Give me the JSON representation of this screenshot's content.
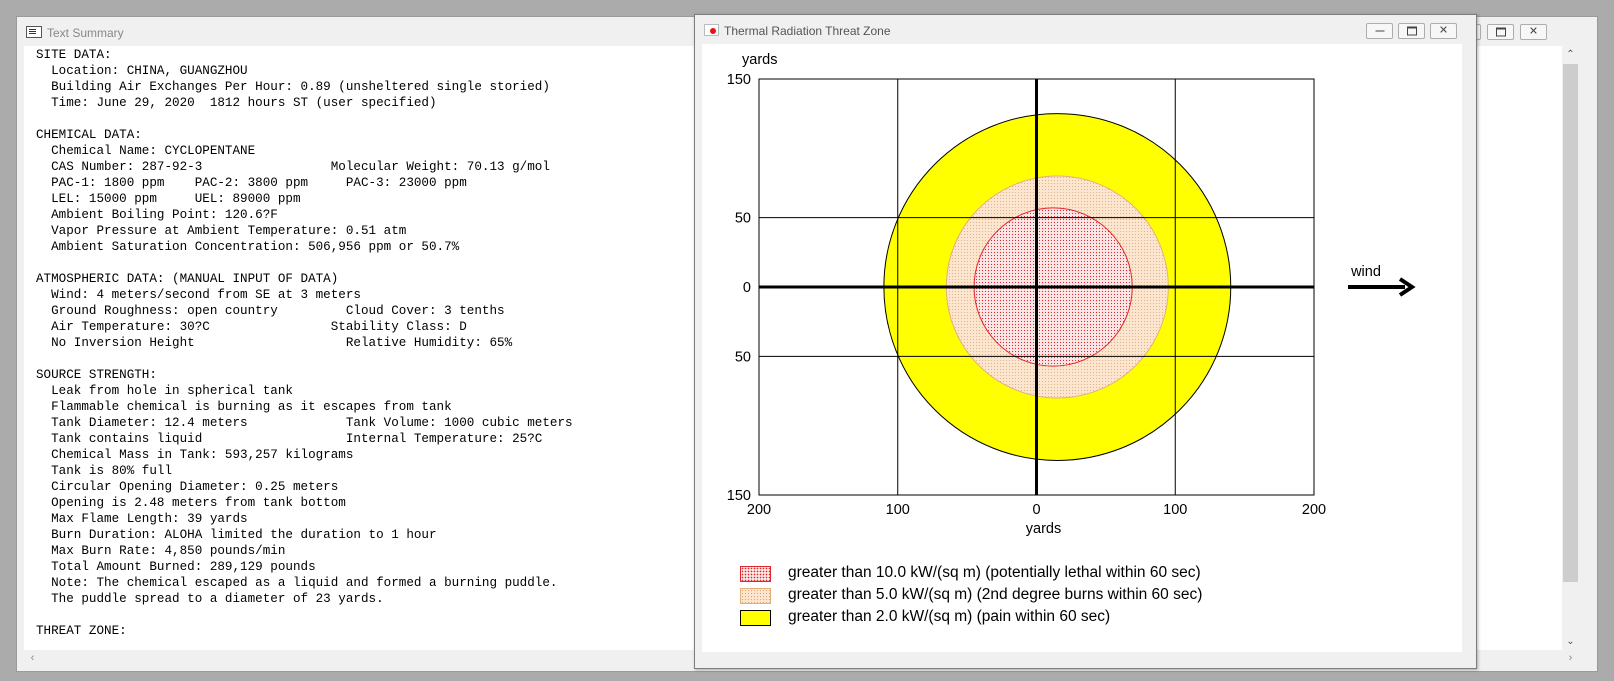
{
  "text_window": {
    "title": "Text Summary",
    "lines": [
      "SITE DATA:",
      "  Location: CHINA, GUANGZHOU",
      "  Building Air Exchanges Per Hour: 0.89 (unsheltered single storied)",
      "  Time: June 29, 2020  1812 hours ST (user specified)",
      "",
      "CHEMICAL DATA:",
      "  Chemical Name: CYCLOPENTANE",
      "  CAS Number: 287-92-3                 Molecular Weight: 70.13 g/mol",
      "  PAC-1: 1800 ppm    PAC-2: 3800 ppm     PAC-3: 23000 ppm",
      "  LEL: 15000 ppm     UEL: 89000 ppm",
      "  Ambient Boiling Point: 120.6?F",
      "  Vapor Pressure at Ambient Temperature: 0.51 atm",
      "  Ambient Saturation Concentration: 506,956 ppm or 50.7%",
      "",
      "ATMOSPHERIC DATA: (MANUAL INPUT OF DATA)",
      "  Wind: 4 meters/second from SE at 3 meters",
      "  Ground Roughness: open country         Cloud Cover: 3 tenths",
      "  Air Temperature: 30?C                Stability Class: D",
      "  No Inversion Height                    Relative Humidity: 65%",
      "",
      "SOURCE STRENGTH:",
      "  Leak from hole in spherical tank",
      "  Flammable chemical is burning as it escapes from tank",
      "  Tank Diameter: 12.4 meters             Tank Volume: 1000 cubic meters",
      "  Tank contains liquid                   Internal Temperature: 25?C",
      "  Chemical Mass in Tank: 593,257 kilograms",
      "  Tank is 80% full",
      "  Circular Opening Diameter: 0.25 meters",
      "  Opening is 2.48 meters from tank bottom",
      "  Max Flame Length: 39 yards",
      "  Burn Duration: ALOHA limited the duration to 1 hour",
      "  Max Burn Rate: 4,850 pounds/min",
      "  Total Amount Burned: 289,129 pounds",
      "  Note: The chemical escaped as a liquid and formed a burning puddle.",
      "  The puddle spread to a diameter of 23 yards.",
      "",
      "THREAT ZONE:"
    ]
  },
  "thermal_window": {
    "title": "Thermal Radiation Threat Zone"
  },
  "chart_data": {
    "type": "threat-zone-map",
    "ylabel": "yards",
    "xlabel": "yards",
    "xlim": [
      -200,
      200
    ],
    "ylim": [
      -150,
      150
    ],
    "x_ticks": [
      {
        "value": -200,
        "label": "200"
      },
      {
        "value": -100,
        "label": "100"
      },
      {
        "value": 0,
        "label": "0"
      },
      {
        "value": 100,
        "label": "100"
      },
      {
        "value": 200,
        "label": "200"
      }
    ],
    "y_ticks": [
      {
        "value": 150,
        "label": "150"
      },
      {
        "value": 50,
        "label": "50"
      },
      {
        "value": 0,
        "label": "0"
      },
      {
        "value": -50,
        "label": "50"
      },
      {
        "value": -150,
        "label": "150"
      }
    ],
    "wind_label": "wind",
    "zones": [
      {
        "label": "greater than 2.0 kW/(sq m) (pain within 60 sec)",
        "center_x": 15,
        "radius": 125,
        "color": "#ffff00"
      },
      {
        "label": "greater than 5.0 kW/(sq m) (2nd degree burns within 60 sec)",
        "center_x": 15,
        "radius": 80,
        "color": "#fde6cf"
      },
      {
        "label": "greater than 10.0 kW/(sq m) (potentially lethal within 60 sec)",
        "center_x": 12,
        "radius": 57,
        "color": "#fde8e8"
      }
    ],
    "legend": [
      "greater than 10.0 kW/(sq m) (potentially lethal within 60 sec)",
      "greater than 5.0 kW/(sq m) (2nd degree burns within 60 sec)",
      "greater than 2.0 kW/(sq m) (pain within 60 sec)"
    ]
  }
}
